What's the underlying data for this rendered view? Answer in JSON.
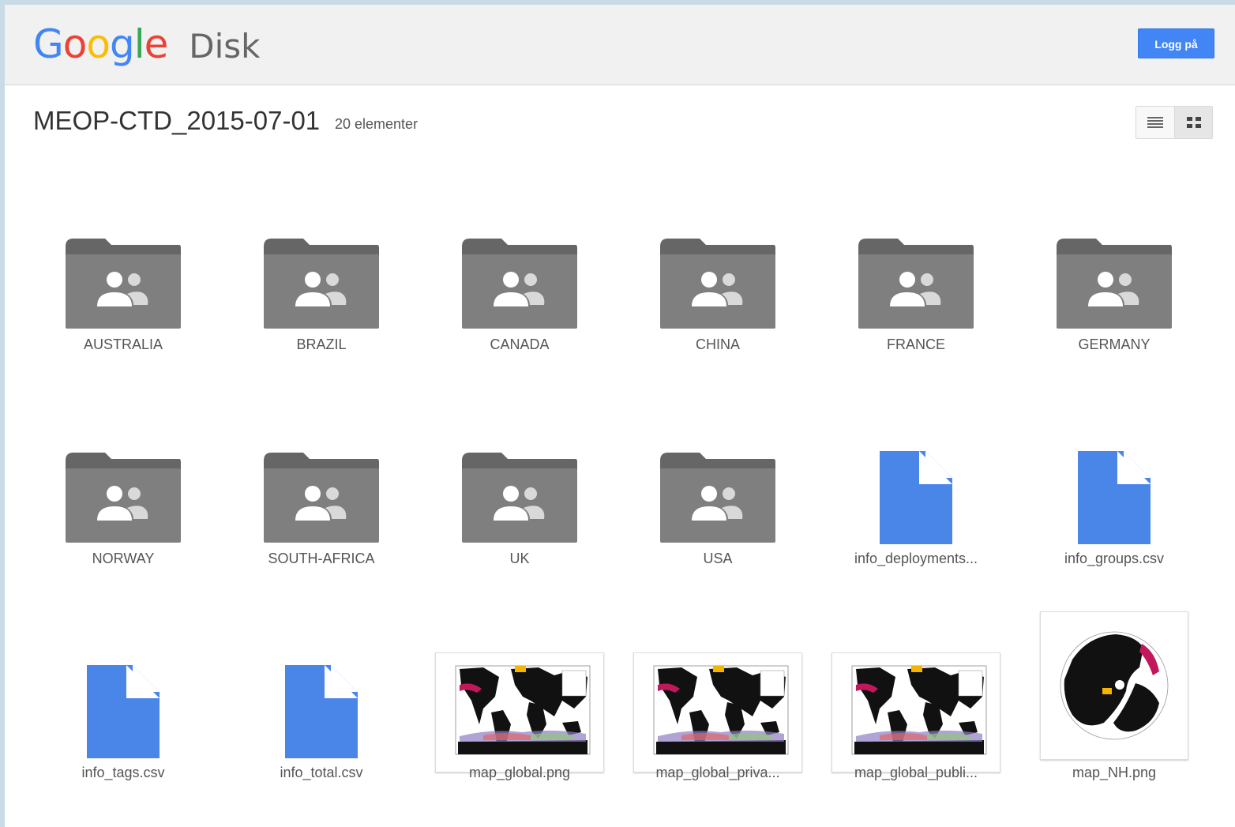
{
  "app": {
    "logo_google": "Google",
    "logo_product": "Disk",
    "login_label": "Logg på",
    "colors": {
      "accent": "#4285f4",
      "folder": "#7f7f7f",
      "folder_tab": "#666666",
      "file": "#4a86e8"
    }
  },
  "header": {
    "folder_title": "MEOP-CTD_2015-07-01",
    "item_count": "20 elementer"
  },
  "view": {
    "modes": [
      {
        "name": "list",
        "icon": "list-view-icon"
      },
      {
        "name": "grid",
        "icon": "grid-view-icon",
        "active": true
      }
    ]
  },
  "items": [
    {
      "type": "shared-folder",
      "label": "AUSTRALIA"
    },
    {
      "type": "shared-folder",
      "label": "BRAZIL"
    },
    {
      "type": "shared-folder",
      "label": "CANADA"
    },
    {
      "type": "shared-folder",
      "label": "CHINA"
    },
    {
      "type": "shared-folder",
      "label": "FRANCE"
    },
    {
      "type": "shared-folder",
      "label": "GERMANY"
    },
    {
      "type": "shared-folder",
      "label": "NORWAY"
    },
    {
      "type": "shared-folder",
      "label": "SOUTH-AFRICA"
    },
    {
      "type": "shared-folder",
      "label": "UK"
    },
    {
      "type": "shared-folder",
      "label": "USA"
    },
    {
      "type": "file",
      "label": "info_deployments..."
    },
    {
      "type": "file",
      "label": "info_groups.csv"
    },
    {
      "type": "file",
      "label": "info_tags.csv"
    },
    {
      "type": "file",
      "label": "info_total.csv"
    },
    {
      "type": "image",
      "label": "map_global.png"
    },
    {
      "type": "image",
      "label": "map_global_priva..."
    },
    {
      "type": "image",
      "label": "map_global_publi..."
    },
    {
      "type": "image-polar",
      "label": "map_NH.png"
    }
  ]
}
